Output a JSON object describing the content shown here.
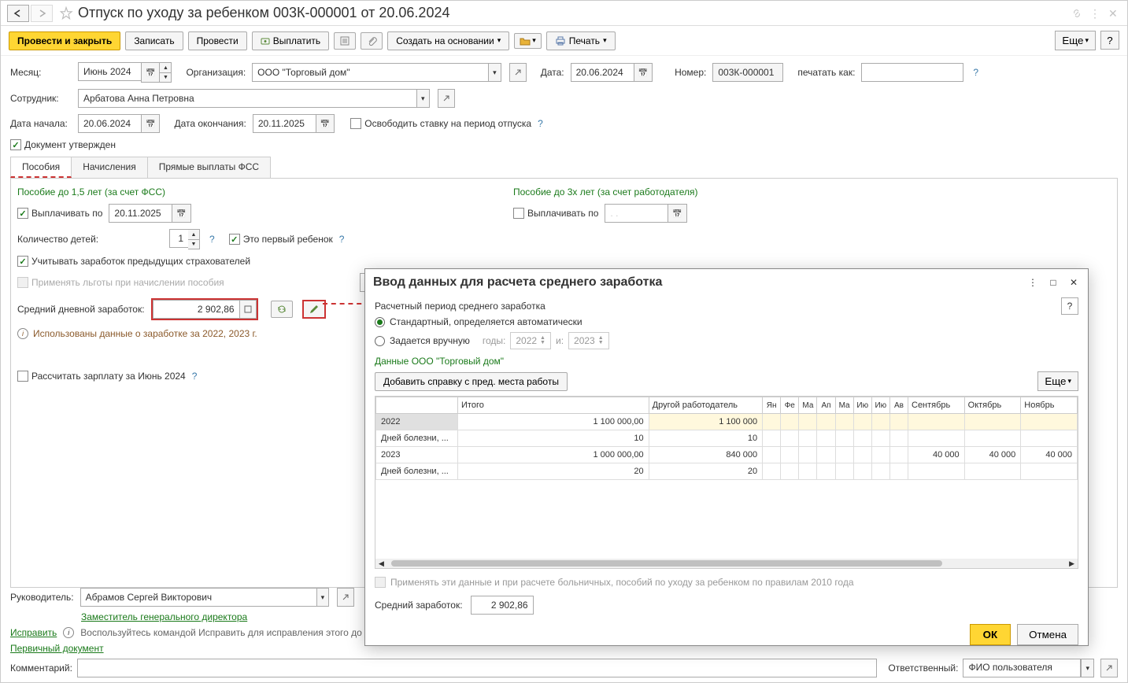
{
  "title": "Отпуск по уходу за ребенком 003К-000001 от 20.06.2024",
  "toolbar": {
    "post_and_close": "Провести и закрыть",
    "save": "Записать",
    "post": "Провести",
    "pay": "Выплатить",
    "create_based": "Создать на основании",
    "print": "Печать",
    "more": "Еще"
  },
  "header": {
    "month_label": "Месяц:",
    "month_value": "Июнь 2024",
    "org_label": "Организация:",
    "org_value": "ООО \"Торговый дом\"",
    "date_label": "Дата:",
    "date_value": "20.06.2024",
    "number_label": "Номер:",
    "number_value": "003К-000001",
    "print_as_label": "печатать как:",
    "employee_label": "Сотрудник:",
    "employee_value": "Арбатова Анна Петровна",
    "start_label": "Дата начала:",
    "start_value": "20.06.2024",
    "end_label": "Дата окончания:",
    "end_value": "20.11.2025",
    "release_rate": "Освободить ставку на период отпуска",
    "approved": "Документ утвержден"
  },
  "tabs": {
    "t1": "Пособия",
    "t2": "Начисления",
    "t3": "Прямые выплаты ФСС"
  },
  "benefits": {
    "left_title": "Пособие до 1,5 лет (за счет ФСС)",
    "right_title": "Пособие до 3х лет (за счет работодателя)",
    "pay_until": "Выплачивать по",
    "pay_until_value": "20.11.2025",
    "children_count_label": "Количество детей:",
    "children_count_value": "1",
    "first_child": "Это первый ребенок",
    "prev_insurers": "Учитывать заработок предыдущих страхователей",
    "apply_benefits": "Применять льготы при начислении пособия",
    "avg_daily_label": "Средний дневной заработок:",
    "avg_daily_value": "2 902,86",
    "info_text": "Использованы данные о заработке за  2022,  2023 г.",
    "calc_salary": "Рассчитать зарплату за Июнь 2024"
  },
  "modal": {
    "title": "Ввод данных для расчета среднего заработка",
    "period_label": "Расчетный период среднего заработка",
    "radio_auto": "Стандартный, определяется автоматически",
    "radio_manual": "Задается вручную",
    "years_label": "годы:",
    "year1": "2022",
    "year_and": "и:",
    "year2": "2023",
    "data_title": "Данные ООО \"Торговый дом\"",
    "add_ref": "Добавить справку с пред. места работы",
    "more": "Еще",
    "table": {
      "col_total": "Итого",
      "col_other": "Другой работодатель",
      "col_jan": "Ян",
      "col_feb": "Фе",
      "col_mar": "Ма",
      "col_apr": "Ап",
      "col_may": "Ма",
      "col_jun": "Ию",
      "col_jul": "Ию",
      "col_aug": "Ав",
      "col_sep": "Сентябрь",
      "col_oct": "Октябрь",
      "col_nov": "Ноябрь",
      "rows": [
        {
          "label": "2022",
          "total": "1 100 000,00",
          "other": "1 100 000",
          "sep": "",
          "oct": "",
          "nov": ""
        },
        {
          "label": "Дней болезни, ...",
          "total": "10",
          "other": "10",
          "sep": "",
          "oct": "",
          "nov": ""
        },
        {
          "label": "2023",
          "total": "1 000 000,00",
          "other": "840 000",
          "sep": "40 000",
          "oct": "40 000",
          "nov": "40 000"
        },
        {
          "label": "Дней болезни, ...",
          "total": "20",
          "other": "20",
          "sep": "",
          "oct": "",
          "nov": ""
        }
      ]
    },
    "apply_data": "Применять эти данные и при расчете больничных, пособий по уходу за ребенком по правилам 2010 года",
    "avg_label": "Средний заработок:",
    "avg_value": "2 902,86",
    "ok": "ОК",
    "cancel": "Отмена"
  },
  "footer": {
    "manager_label": "Руководитель:",
    "manager_value": "Абрамов Сергей Викторович",
    "deputy_link": "Заместитель генерального директора",
    "correct_link": "Исправить",
    "correct_hint": "Воспользуйтесь командой Исправить для исправления этого до",
    "primary_doc": "Первичный документ",
    "comment_label": "Комментарий:",
    "responsible_label": "Ответственный:",
    "responsible_value": "ФИО пользователя"
  }
}
